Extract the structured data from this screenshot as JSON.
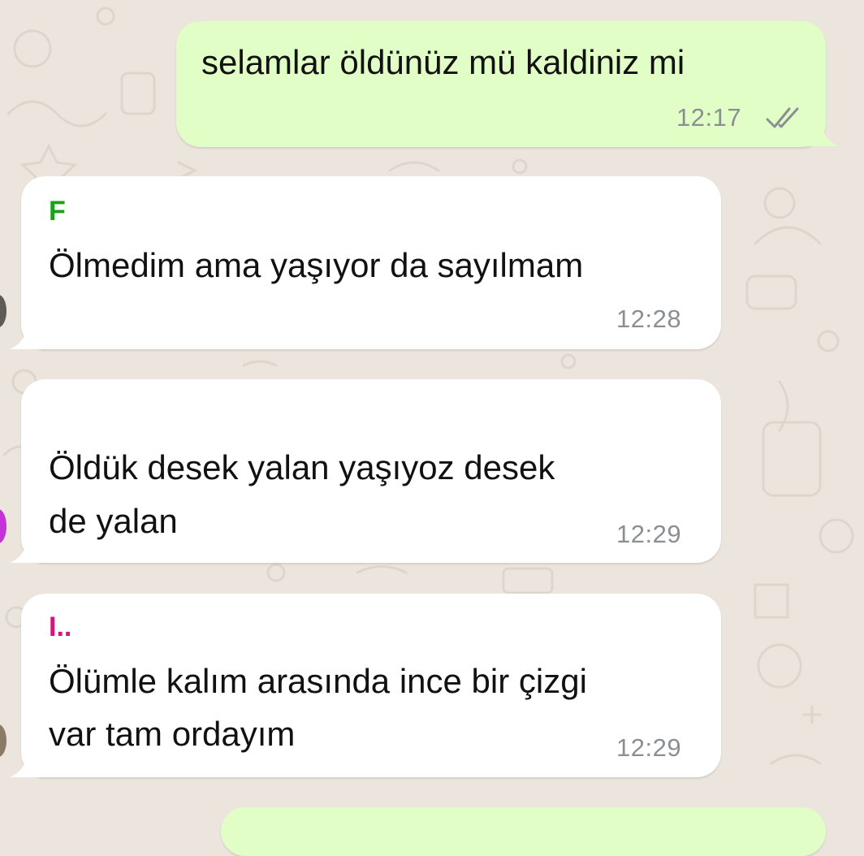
{
  "colors": {
    "background": "#ebe5dd",
    "outgoing_bubble": "#e1fec6",
    "incoming_bubble": "#ffffff",
    "time_text": "#8a8f93",
    "read_receipt": "#8a8f93",
    "sender_green": "#1aa01a",
    "sender_magenta": "#d4157a"
  },
  "messages": [
    {
      "direction": "outgoing",
      "text": "selamlar öldünüz mü kaldiniz mi",
      "time": "12:17",
      "status_icon": "double-check-icon"
    },
    {
      "direction": "incoming",
      "sender": "F",
      "lines": [
        "Ölmedim ama yaşıyor da sayılmam"
      ],
      "time": "12:28"
    },
    {
      "direction": "incoming",
      "sender": "",
      "lines": [
        "Öldük desek yalan yaşıyoz desek",
        "de yalan"
      ],
      "time": "12:29"
    },
    {
      "direction": "incoming",
      "sender": "I..",
      "lines": [
        "Ölümle kalım arasında ince bir çizgi",
        "var tam ordayım"
      ],
      "time": "12:29"
    }
  ]
}
